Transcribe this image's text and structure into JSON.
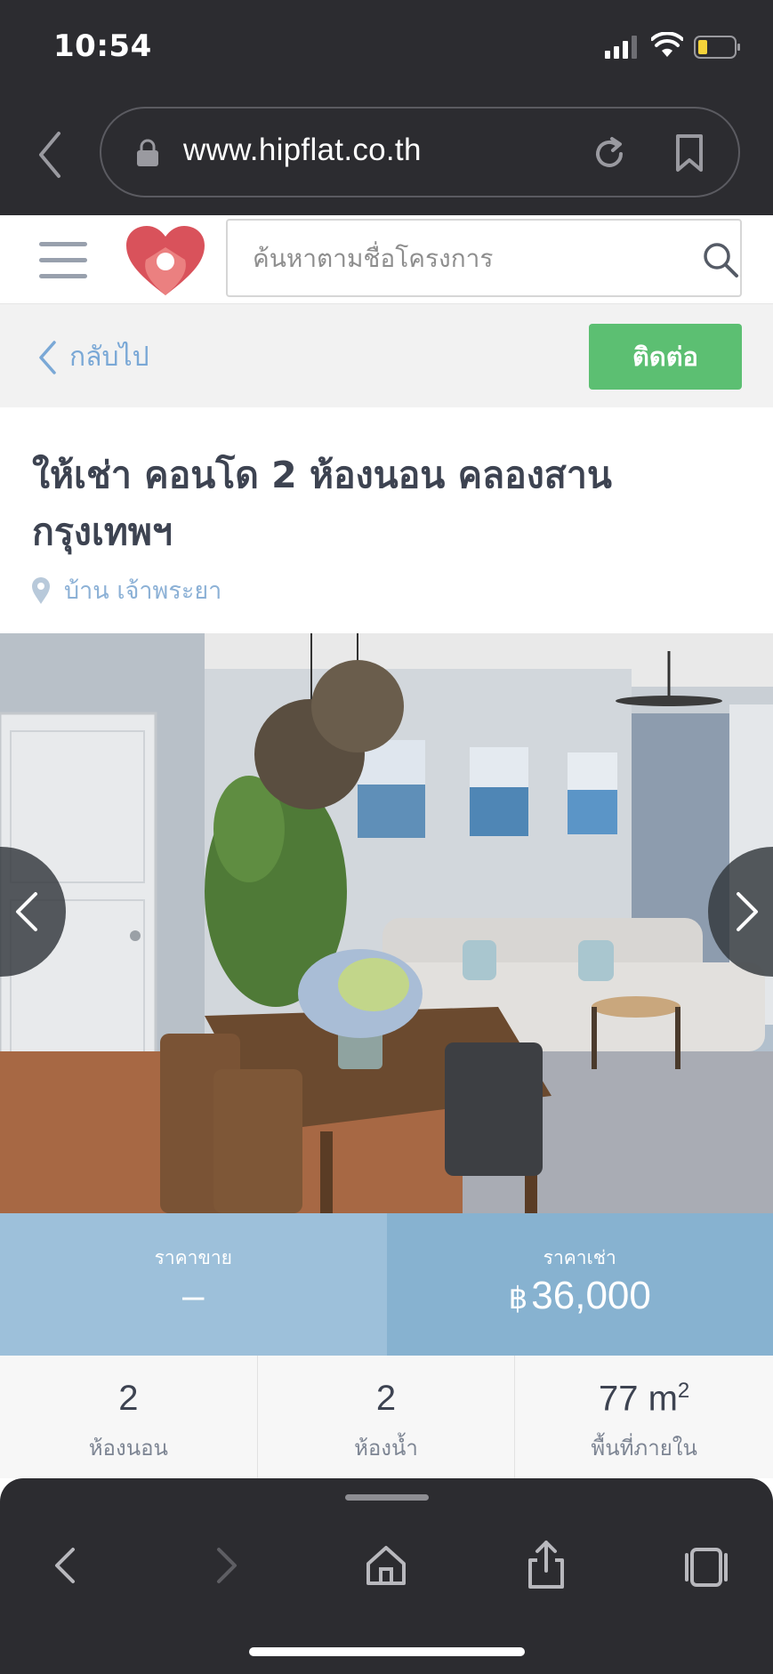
{
  "status_bar": {
    "time": "10:54"
  },
  "browser": {
    "url": "www.hipflat.co.th"
  },
  "header": {
    "search_placeholder": "ค้นหาตามชื่อโครงการ"
  },
  "action_bar": {
    "back_label": "กลับไป",
    "contact_label": "ติดต่อ"
  },
  "listing": {
    "title": "ให้เช่า คอนโด 2 ห้องนอน คลองสาน กรุงเทพฯ",
    "location": "บ้าน เจ้าพระยา"
  },
  "price": {
    "sale_label": "ราคาขาย",
    "sale_value": "–",
    "rent_label": "ราคาเช่า",
    "currency_symbol": "฿",
    "rent_value": "36,000"
  },
  "specs": {
    "bedrooms_value": "2",
    "bedrooms_label": "ห้องนอน",
    "bathrooms_value": "2",
    "bathrooms_label": "ห้องน้ำ",
    "area_value": "77 m",
    "area_unit_sup": "2",
    "area_label": "พื้นที่ภายใน"
  },
  "colors": {
    "accent_green": "#5cbf72",
    "link_blue": "#7aa8d6",
    "price_sale_bg": "#9dc0da",
    "price_rent_bg": "#87b2d0",
    "browser_chrome": "#2c2c30"
  },
  "icons": [
    "signal-icon",
    "wifi-icon",
    "battery-icon",
    "back-chevron-icon",
    "lock-icon",
    "reload-icon",
    "bookmark-icon",
    "menu-icon",
    "logo-heart-icon",
    "search-icon",
    "pin-icon",
    "prev-arrow-icon",
    "next-arrow-icon",
    "toolbar-back-icon",
    "toolbar-forward-icon",
    "home-icon",
    "share-icon",
    "tabs-icon"
  ]
}
